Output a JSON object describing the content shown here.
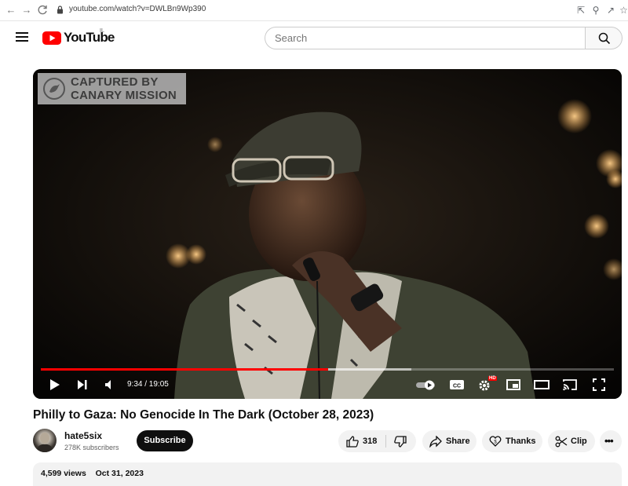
{
  "browser": {
    "url": "youtube.com/watch?v=DWLBn9Wp390"
  },
  "masthead": {
    "logo_text": "YouTube",
    "country_code": "IL",
    "search_placeholder": "Search"
  },
  "player": {
    "watermark_line1": "CAPTURED BY",
    "watermark_line2": "CANARY MISSION",
    "time_display": "9:34 / 19:05",
    "progress_fraction": 0.502,
    "buffered_fraction": 0.647,
    "hd_badge": "HD"
  },
  "video": {
    "title": "Philly to Gaza: No Genocide In The Dark (October 28, 2023)"
  },
  "channel": {
    "name": "hate5six",
    "subscribers": "278K subscribers",
    "subscribe_label": "Subscribe"
  },
  "actions": {
    "likes": "318",
    "share_label": "Share",
    "thanks_label": "Thanks",
    "clip_label": "Clip"
  },
  "description": {
    "views": "4,599 views",
    "date": "Oct 31, 2023"
  },
  "colors": {
    "brand_red": "#ff0000",
    "progress_red": "#ff0000"
  }
}
